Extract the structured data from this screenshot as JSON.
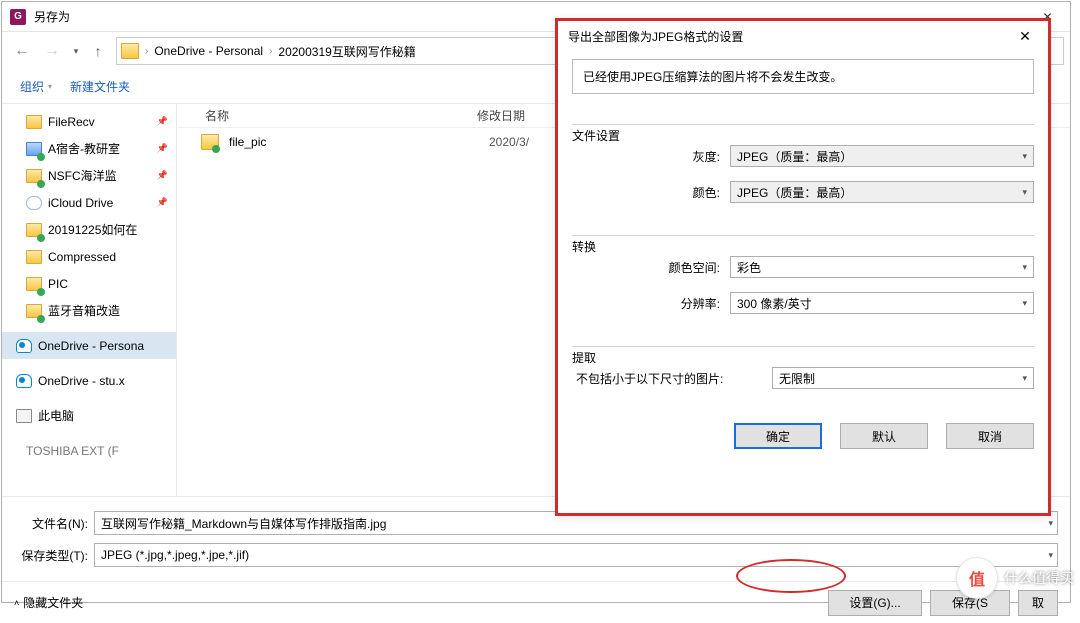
{
  "window": {
    "title": "另存为",
    "app_icon_letter": "G"
  },
  "nav": {
    "crumbs": [
      "OneDrive - Personal",
      "20200319互联网写作秘籍"
    ]
  },
  "toolbar": {
    "organize": "组织",
    "new_folder": "新建文件夹"
  },
  "sidebar": {
    "items": [
      {
        "label": "FileRecv",
        "icon": "folder",
        "pinned": true,
        "check": false
      },
      {
        "label": "A宿舍-教研室",
        "icon": "folder-blue",
        "pinned": true,
        "check": true
      },
      {
        "label": "NSFC海洋监",
        "icon": "folder",
        "pinned": true,
        "check": true
      },
      {
        "label": "iCloud Drive",
        "icon": "cloud",
        "pinned": true,
        "check": false
      },
      {
        "label": "20191225如何在",
        "icon": "folder",
        "pinned": false,
        "check": true
      },
      {
        "label": "Compressed",
        "icon": "folder",
        "pinned": false,
        "check": false
      },
      {
        "label": "PIC",
        "icon": "folder",
        "pinned": false,
        "check": true
      },
      {
        "label": "蓝牙音箱改造",
        "icon": "folder",
        "pinned": false,
        "check": true
      },
      {
        "label": "OneDrive - Persona",
        "icon": "onedrive",
        "pinned": false,
        "check": false,
        "selected": true
      },
      {
        "label": "OneDrive - stu.x",
        "icon": "onedrive",
        "pinned": false,
        "check": false
      },
      {
        "label": "此电脑",
        "icon": "pc",
        "pinned": false,
        "check": false
      },
      {
        "label": "TOSHIBA EXT (F",
        "icon": "drive",
        "pinned": false,
        "check": false
      }
    ]
  },
  "filelist": {
    "columns": {
      "name": "名称",
      "date": "修改日期"
    },
    "rows": [
      {
        "name": "file_pic",
        "date": "2020/3/"
      }
    ]
  },
  "footer": {
    "filename_label": "文件名(N):",
    "filename_value": "互联网写作秘籍_Markdown与自媒体写作排版指南.jpg",
    "type_label": "保存类型(T):",
    "type_value": "JPEG (*.jpg,*.jpeg,*.jpe,*.jif)",
    "hide_folders": "隐藏文件夹",
    "btn_settings": "设置(G)...",
    "btn_save": "保存(S",
    "btn_cancel": "取"
  },
  "dialog": {
    "title": "导出全部图像为JPEG格式的设置",
    "info": "已经使用JPEG压缩算法的图片将不会发生改变。",
    "section_file": "文件设置",
    "gray_label": "灰度:",
    "gray_value": "JPEG（质量：最高）",
    "color_label": "颜色:",
    "color_value": "JPEG（质量：最高）",
    "section_convert": "转换",
    "colorspace_label": "颜色空间:",
    "colorspace_value": "彩色",
    "resolution_label": "分辨率:",
    "resolution_value": "300 像素/英寸",
    "section_extract": "提取",
    "exclude_label": "不包括小于以下尺寸的图片:",
    "exclude_value": "无限制",
    "btn_ok": "确定",
    "btn_default": "默认",
    "btn_cancel": "取消"
  },
  "watermark": {
    "glyph": "值",
    "text": "什么值得买"
  }
}
